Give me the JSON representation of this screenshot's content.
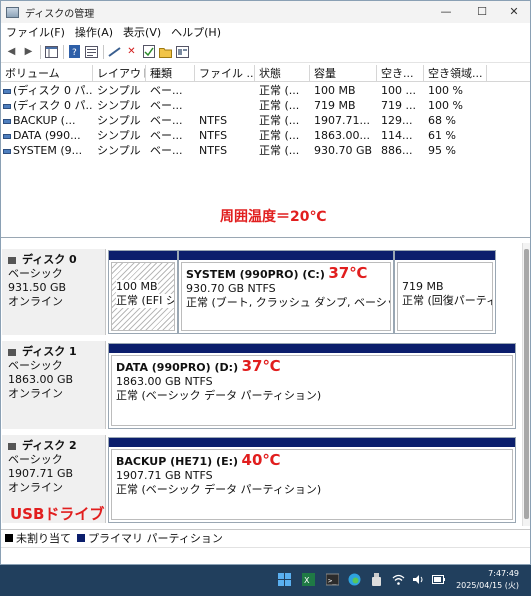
{
  "window": {
    "title": "ディスクの管理",
    "minimize": "—",
    "maximize": "☐",
    "close": "✕"
  },
  "menu": [
    "ファイル(F)",
    "操作(A)",
    "表示(V)",
    "ヘルプ(H)"
  ],
  "toolbar": {
    "icons": [
      "back-icon",
      "forward-icon",
      "console-icon",
      "help-icon",
      "properties-icon",
      "connect-icon",
      "delete-icon",
      "check-icon",
      "folder-icon",
      "settings-icon"
    ]
  },
  "table": {
    "headers": [
      "ボリューム",
      "レイアウト",
      "種類",
      "ファイル ...",
      "状態",
      "容量",
      "空き...",
      "空き領域..."
    ],
    "rows": [
      [
        "(ディスク 0 パ...",
        "シンプル",
        "ベー...",
        "",
        "正常 (...",
        "100 MB",
        "100 ...",
        "100 %"
      ],
      [
        "(ディスク 0 パ...",
        "シンプル",
        "ベー...",
        "",
        "正常 (...",
        "719 MB",
        "719 ...",
        "100 %"
      ],
      [
        "BACKUP (...",
        "シンプル",
        "ベー...",
        "NTFS",
        "正常 (...",
        "1907.71...",
        "129...",
        "68 %"
      ],
      [
        "DATA (990...",
        "シンプル",
        "ベー...",
        "NTFS",
        "正常 (...",
        "1863.00...",
        "114...",
        "61 %"
      ],
      [
        "SYSTEM (9...",
        "シンプル",
        "ベー...",
        "NTFS",
        "正常 (...",
        "930.70 GB",
        "886...",
        "95 %"
      ]
    ]
  },
  "annotation": {
    "ambient": "周囲温度＝20℃",
    "usb": "USBドライブ"
  },
  "disks": [
    {
      "name": "ディスク 0",
      "type": "ベーシック",
      "size": "931.50 GB",
      "status": "オンライン",
      "partitions": [
        {
          "title": "",
          "size": "100 MB",
          "desc": "正常 (EFI シ",
          "temp": ""
        },
        {
          "title": "SYSTEM (990PRO) (C:)",
          "size": "930.70 GB NTFS",
          "desc": "正常 (ブート, クラッシュ ダンプ, ベーシック デー",
          "temp": "37℃"
        },
        {
          "title": "",
          "size": "719 MB",
          "desc": "正常 (回復パーティ",
          "temp": ""
        }
      ]
    },
    {
      "name": "ディスク 1",
      "type": "ベーシック",
      "size": "1863.00 GB",
      "status": "オンライン",
      "partitions": [
        {
          "title": "DATA (990PRO) (D:)",
          "size": "1863.00 GB NTFS",
          "desc": "正常 (ベーシック データ パーティション)",
          "temp": "37℃"
        }
      ]
    },
    {
      "name": "ディスク 2",
      "type": "ベーシック",
      "size": "1907.71 GB",
      "status": "オンライン",
      "partitions": [
        {
          "title": "BACKUP (HE71) (E:)",
          "size": "1907.71 GB NTFS",
          "desc": "正常 (ベーシック データ パーティション)",
          "temp": "40℃"
        }
      ]
    }
  ],
  "legend": {
    "unallocated": "未割り当て",
    "primary": "プライマリ パーティション",
    "unallocated_color": "#000000",
    "primary_color": "#0b1e6c"
  },
  "taskbar": {
    "time": "7:47:49",
    "date": "2025/04/15 (火)",
    "icons": [
      "start-icon",
      "excel-icon",
      "terminal-icon",
      "edge-icon",
      "usb-icon",
      "wifi-icon",
      "volume-icon",
      "battery-icon"
    ]
  }
}
